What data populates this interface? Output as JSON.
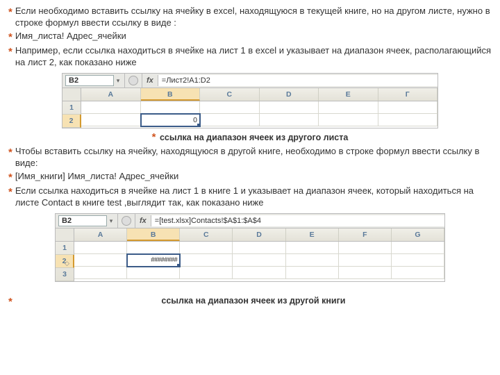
{
  "p1": "Если необходимо вставить ссылку на ячейку в excel, находящуюся в текущей книге, но на другом листе, нужно в строке формул ввести ссылку в виде :",
  "p2": "Имя_листа! Адрес_ячейки",
  "p3": "Например, если ссылка находиться в ячейке на  лист 1 в excel и указывает на диапазон ячеек, располагающийся  на лист 2, как показано ниже",
  "fig1": {
    "namebox": "B2",
    "formula": "=Лист2!A1:D2",
    "cols": [
      "A",
      "B",
      "C",
      "D",
      "E",
      "Г"
    ],
    "rows": [
      "1",
      "2"
    ],
    "b2": "0"
  },
  "cap1": "ссылка на диапазон ячеек из другого листа",
  "p4": "Чтобы вставить ссылку на ячейку, находящуюся в другой книге, необходимо в строке формул ввести ссылку в виде:",
  "p5": "[Имя_книги] Имя_листа! Адрес_ячейки",
  "p6": "Если ссылка находиться в ячейке на лист 1 в книге 1 и указывает на диапазон ячеек, который находиться на листе Contact в книге test ,выглядит так, как показано ниже",
  "fig2": {
    "namebox": "B2",
    "formula": "=[test.xlsx]Contacts!$A$1:$A$4",
    "cols": [
      "A",
      "B",
      "C",
      "D",
      "E",
      "F",
      "G"
    ],
    "rows": [
      "1",
      "2",
      "3"
    ],
    "b2": "########"
  },
  "cap2": "ссылка на диапазон ячеек из другой книги",
  "star": "*",
  "fx": "fx"
}
